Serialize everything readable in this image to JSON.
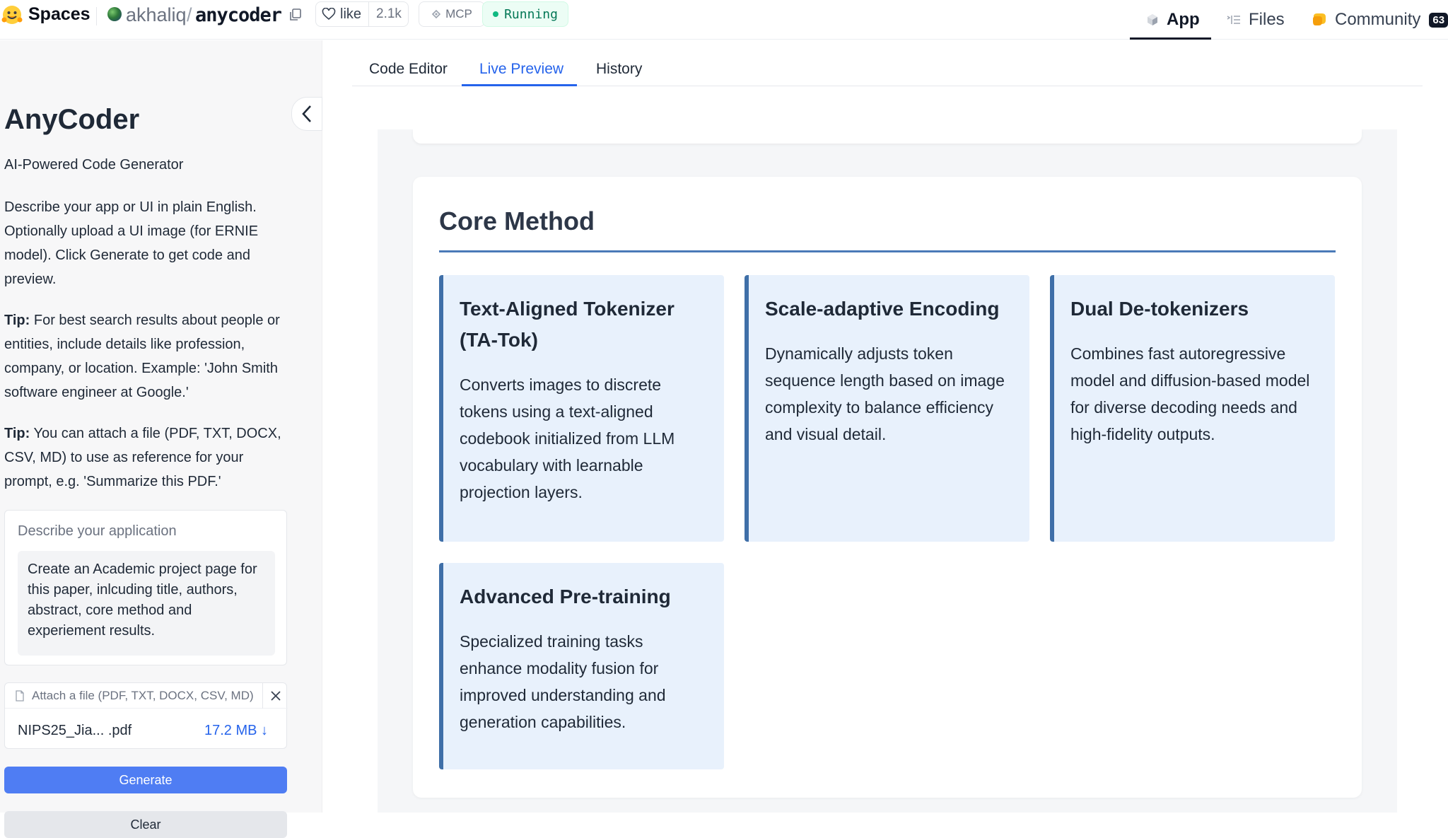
{
  "topbar": {
    "spaces_label": "Spaces",
    "repo_owner": "akhaliq",
    "repo_slash": "/",
    "repo_name": "anycoder",
    "like_label": "like",
    "like_count": "2.1k",
    "mcp_label": "MCP",
    "status_label": "Running",
    "nav": {
      "app": "App",
      "files": "Files",
      "community": "Community",
      "community_count": "63"
    }
  },
  "sidebar": {
    "title": "AnyCoder",
    "subtitle": "AI-Powered Code Generator",
    "intro": "Describe your app or UI in plain English. Optionally upload a UI image (for ERNIE model). Click Generate to get code and preview.",
    "tip1_label": "Tip:",
    "tip1_text": " For best search results about people or entities, include details like profession, company, or location. Example: 'John Smith software engineer at Google.'",
    "tip2_label": "Tip:",
    "tip2_text": " You can attach a file (PDF, TXT, DOCX, CSV, MD) to use as reference for your prompt, e.g. 'Summarize this PDF.'",
    "prompt_label": "Describe your application",
    "prompt_value": "Create an Academic project page for this paper, inlcuding title, authors, abstract, core method and experiement results.",
    "attach_label": "Attach a file (PDF, TXT, DOCX, CSV, MD)",
    "file_name": "NIPS25_Jia... .pdf",
    "file_size": "17.2 MB ↓",
    "generate_label": "Generate",
    "clear_label": "Clear"
  },
  "tabs": {
    "code_editor": "Code Editor",
    "live_preview": "Live Preview",
    "history": "History",
    "active": "Live Preview"
  },
  "preview": {
    "section_title": "Core Method",
    "cards": [
      {
        "title": "Text-Aligned Tokenizer (TA-Tok)",
        "text": "Converts images to discrete tokens using a text-aligned codebook initialized from LLM vocabulary with learnable projection layers."
      },
      {
        "title": "Scale-adaptive Encoding",
        "text": "Dynamically adjusts token sequence length based on image complexity to balance efficiency and visual detail."
      },
      {
        "title": "Dual De-tokenizers",
        "text": "Combines fast autoregressive model and diffusion-based model for diverse decoding needs and high-fidelity outputs."
      },
      {
        "title": "Advanced Pre-training",
        "text": "Specialized training tasks enhance modality fusion for improved understanding and generation capabilities."
      }
    ]
  },
  "colors": {
    "accent_blue": "#2563eb",
    "generate_button": "#4f7df3",
    "card_bg": "#e8f1fc",
    "card_border": "#3f6fa8",
    "running_green": "#10b981"
  },
  "icons": [
    "hf-logo-icon",
    "copy-icon",
    "heart-icon",
    "mcp-icon",
    "app-cube-icon",
    "files-icon",
    "community-icon",
    "chevron-left-icon",
    "file-icon",
    "close-icon"
  ]
}
